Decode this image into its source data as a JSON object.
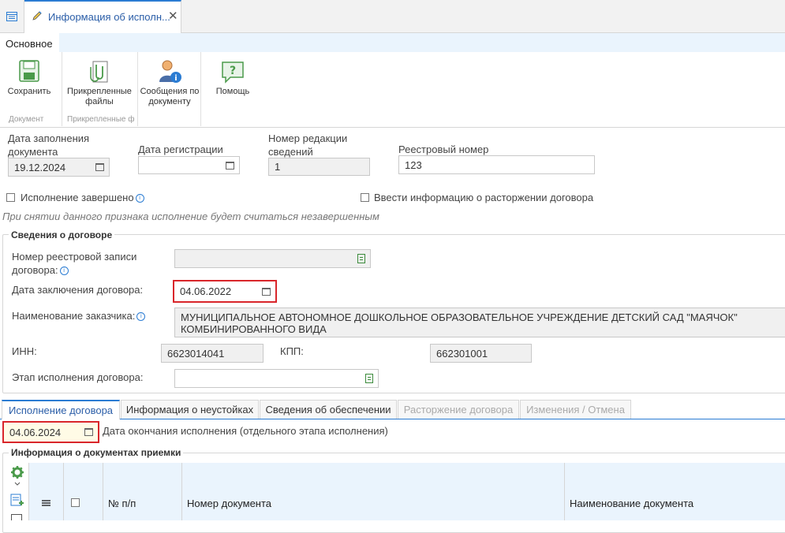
{
  "tabs": {
    "home_icon": "grid-icon",
    "document_tab_title": "Информация об исполн...",
    "close_symbol": "✕"
  },
  "ribbon": {
    "active_tab": "Основное",
    "buttons": {
      "save": "Сохранить",
      "attached_files": "Прикрепленные файлы",
      "messages": "Сообщения по документу",
      "help": "Помощь"
    },
    "groups": {
      "document": "Документ",
      "attached": "Прикрепленные ф"
    }
  },
  "header_fields": {
    "fill_date_label": "Дата заполнения документа",
    "fill_date_value": "19.12.2024",
    "registration_date_label": "Дата регистрации",
    "registration_date_value": "",
    "revision_number_label": "Номер редакции сведений",
    "revision_number_value": "1",
    "registry_number_label": "Реестровый номер",
    "registry_number_value": "123"
  },
  "flags": {
    "completed_label": "Исполнение завершено",
    "termination_label": "Ввести информацию о расторжении договора",
    "hint": "При снятии данного признака исполнение будет считаться незавершенным"
  },
  "contract": {
    "section_title": "Сведения о договоре",
    "registry_record_label": "Номер реестровой записи договора:",
    "registry_record_value": "",
    "conclusion_date_label": "Дата заключения договора:",
    "conclusion_date_value": "04.06.2022",
    "customer_label": "Наименование заказчика:",
    "customer_value": "МУНИЦИПАЛЬНОЕ АВТОНОМНОЕ ДОШКОЛЬНОЕ ОБРАЗОВАТЕЛЬНОЕ УЧРЕЖДЕНИЕ  ДЕТСКИЙ САД \"МАЯЧОК\" КОМБИНИРОВАННОГО ВИДА",
    "inn_label": "ИНН:",
    "inn_value": "6623014041",
    "kpp_label": "КПП:",
    "kpp_value": "662301001",
    "stage_label": "Этап исполнения договора:",
    "stage_value": ""
  },
  "bottom_tabs": [
    {
      "label": "Исполнение договора",
      "state": "active"
    },
    {
      "label": "Информация о неустойках",
      "state": "normal"
    },
    {
      "label": "Сведения об обеспечении",
      "state": "normal"
    },
    {
      "label": "Расторжение договора",
      "state": "disabled"
    },
    {
      "label": "Изменения / Отмена",
      "state": "disabled"
    }
  ],
  "execution": {
    "end_date_value": "04.06.2024",
    "end_date_label": "Дата окончания исполнения (отдельного этапа исполнения)",
    "acceptance_section_title": "Информация о документах приемки"
  },
  "grid": {
    "columns": [
      "№ п/п",
      "Номер документа",
      "Наименование документа"
    ]
  },
  "colors": {
    "accent": "#2b7cd3",
    "highlight_border": "#d9262b",
    "grid_header_bg": "#eaf4fd"
  }
}
